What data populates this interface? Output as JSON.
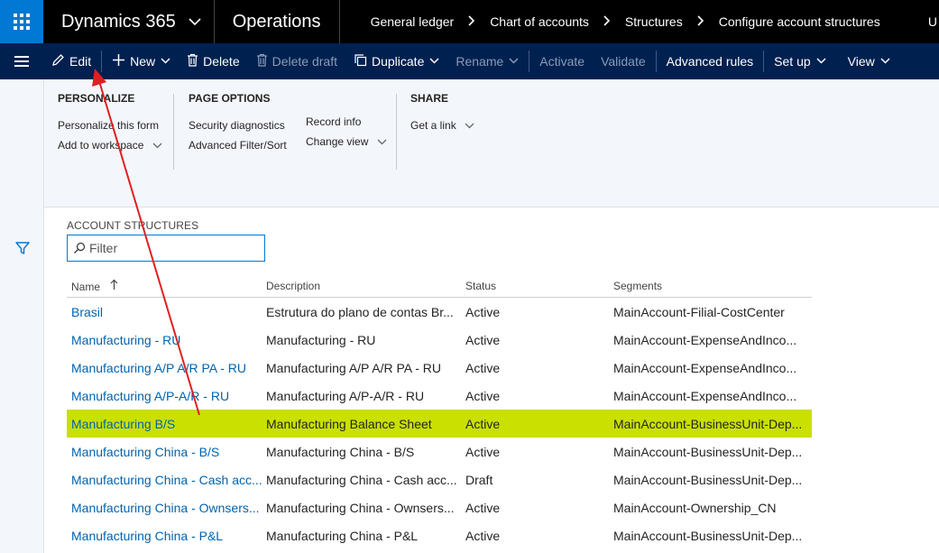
{
  "topbar": {
    "app_name": "Dynamics 365",
    "module_name": "Operations",
    "breadcrumbs": [
      "General ledger",
      "Chart of accounts",
      "Structures",
      "Configure account structures"
    ],
    "user_initial": "U"
  },
  "actions": {
    "edit": "Edit",
    "new": "New",
    "delete": "Delete",
    "delete_draft": "Delete draft",
    "duplicate": "Duplicate",
    "rename": "Rename",
    "activate": "Activate",
    "validate": "Validate",
    "advanced_rules": "Advanced rules",
    "set_up": "Set up",
    "view": "View"
  },
  "options": {
    "personalize": {
      "title": "PERSONALIZE",
      "items": [
        "Personalize this form",
        "Add to workspace"
      ]
    },
    "page_options": {
      "title": "PAGE OPTIONS",
      "items": [
        "Security diagnostics",
        "Advanced Filter/Sort",
        "Record info",
        "Change view"
      ]
    },
    "share": {
      "title": "SHARE",
      "items": [
        "Get a link"
      ]
    }
  },
  "list": {
    "section_title": "ACCOUNT STRUCTURES",
    "filter_placeholder": "Filter",
    "columns": [
      "Name",
      "Description",
      "Status",
      "Segments"
    ],
    "rows": [
      {
        "name": "Brasil",
        "description": "Estrutura do plano de contas Br...",
        "status": "Active",
        "segments": "MainAccount-Filial-CostCenter"
      },
      {
        "name": "Manufacturing - RU",
        "description": "Manufacturing - RU",
        "status": "Active",
        "segments": "MainAccount-ExpenseAndInco..."
      },
      {
        "name": "Manufacturing A/P A/R PA - RU",
        "description": "Manufacturing A/P A/R PA - RU",
        "status": "Active",
        "segments": "MainAccount-ExpenseAndInco..."
      },
      {
        "name": "Manufacturing A/P-A/R - RU",
        "description": "Manufacturing A/P-A/R - RU",
        "status": "Active",
        "segments": "MainAccount-ExpenseAndInco..."
      },
      {
        "name": "Manufacturing B/S",
        "description": "Manufacturing Balance Sheet",
        "status": "Active",
        "segments": "MainAccount-BusinessUnit-Dep..."
      },
      {
        "name": "Manufacturing China - B/S",
        "description": "Manufacturing China - B/S",
        "status": "Active",
        "segments": "MainAccount-BusinessUnit-Dep..."
      },
      {
        "name": "Manufacturing China - Cash acc...",
        "description": "Manufacturing China - Cash acc...",
        "status": "Draft",
        "segments": "MainAccount-BusinessUnit-Dep..."
      },
      {
        "name": "Manufacturing China - Ownsers...",
        "description": "Manufacturing China - Ownsers...",
        "status": "Active",
        "segments": "MainAccount-Ownership_CN"
      },
      {
        "name": "Manufacturing China - P&L",
        "description": "Manufacturing China - P&L",
        "status": "Active",
        "segments": "MainAccount-BusinessUnit-Dep..."
      }
    ],
    "selected_row": 4
  },
  "colors": {
    "topbar": "#000000",
    "actionbar": "#002050",
    "accent": "#0078d4",
    "selected_row": "#c9e000",
    "link": "#0063b1",
    "annotation_arrow": "#e02020"
  }
}
